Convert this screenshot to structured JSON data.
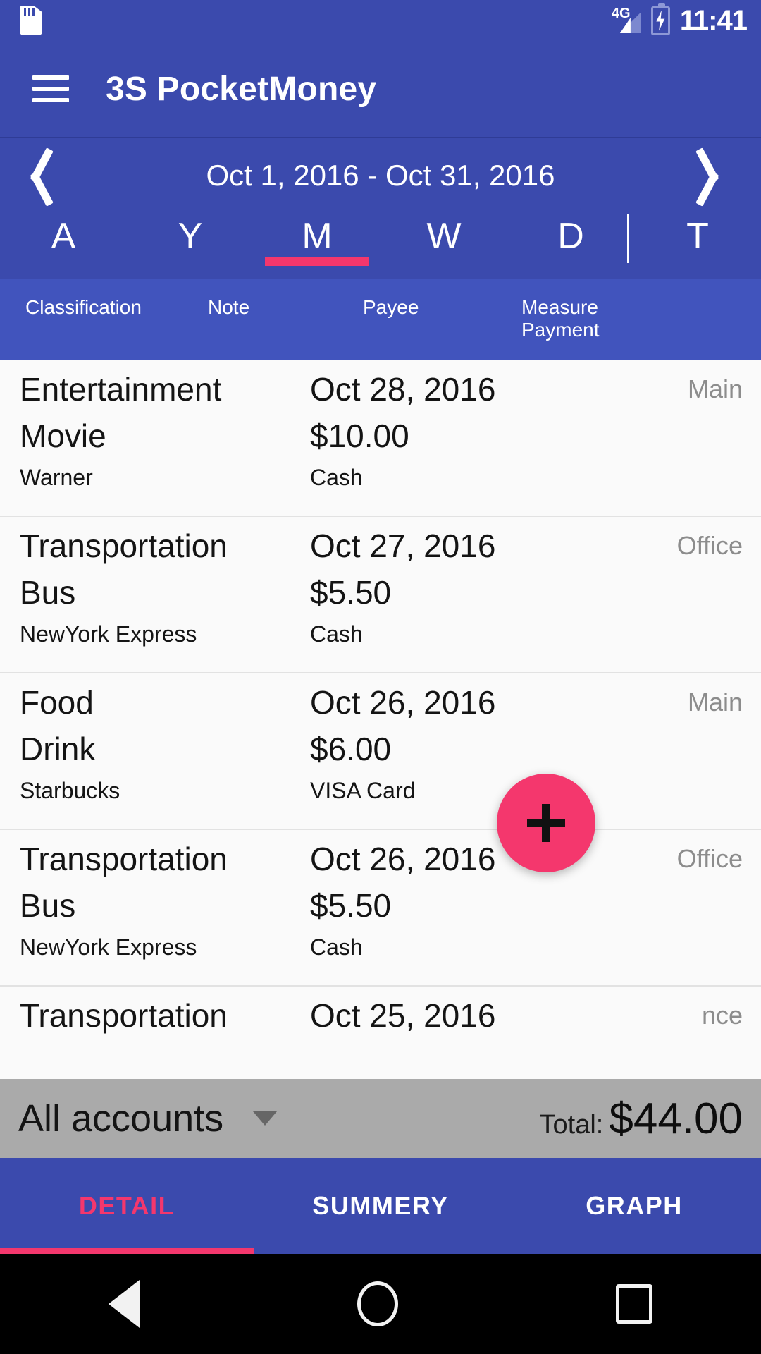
{
  "status_bar": {
    "sd_card_icon": "sd-card-icon",
    "network_label": "4G",
    "signal_icon": "signal-bars-icon",
    "battery_icon": "battery-charging-icon",
    "clock": "11:41"
  },
  "app_bar": {
    "menu_icon": "hamburger-menu-icon",
    "title": "3S PocketMoney"
  },
  "date_nav": {
    "prev_icon": "chevron-left-icon",
    "next_icon": "chevron-right-icon",
    "range": "Oct 1, 2016 - Oct 31, 2016"
  },
  "period_tabs": {
    "items": [
      {
        "label": "A",
        "active": false
      },
      {
        "label": "Y",
        "active": false
      },
      {
        "label": "M",
        "active": true
      },
      {
        "label": "W",
        "active": false
      },
      {
        "label": "D",
        "active": false
      },
      {
        "label": "T",
        "active": false
      }
    ],
    "active_indicator_color": "#f4376d"
  },
  "column_headers": {
    "classification": "Classification",
    "note": "Note",
    "payee": "Payee",
    "measure": "Measure",
    "payment": "Payment"
  },
  "transactions": [
    {
      "classification": "Entertainment",
      "note": "Movie",
      "payee": "Warner",
      "date": "Oct 28, 2016",
      "amount": "$10.00",
      "payment": "Cash",
      "account": "Main"
    },
    {
      "classification": "Transportation",
      "note": "Bus",
      "payee": "NewYork Express",
      "date": "Oct 27, 2016",
      "amount": "$5.50",
      "payment": "Cash",
      "account": "Office"
    },
    {
      "classification": "Food",
      "note": "Drink",
      "payee": "Starbucks",
      "date": "Oct 26, 2016",
      "amount": "$6.00",
      "payment": "VISA Card",
      "account": "Main"
    },
    {
      "classification": "Transportation",
      "note": "Bus",
      "payee": "NewYork Express",
      "date": "Oct 26, 2016",
      "amount": "$5.50",
      "payment": "Cash",
      "account": "Office"
    }
  ],
  "partial_row": {
    "classification": "Transportation",
    "date": "Oct 25, 2016",
    "account": "nce"
  },
  "fab": {
    "icon": "plus-icon",
    "color": "#f4376d"
  },
  "totals_bar": {
    "account_filter": "All accounts",
    "dropdown_icon": "caret-down-icon",
    "total_label": "Total:",
    "total_value": "$44.00"
  },
  "bottom_tabs": {
    "items": [
      {
        "label": "DETAIL",
        "active": true
      },
      {
        "label": "SUMMERY",
        "active": false
      },
      {
        "label": "GRAPH",
        "active": false
      }
    ],
    "active_color": "#f4376d"
  },
  "nav_bar": {
    "back_icon": "back-triangle-icon",
    "home_icon": "home-circle-icon",
    "recents_icon": "recents-square-icon"
  },
  "theme": {
    "primary": "#3b4aad",
    "primary_light": "#4154bd",
    "accent": "#f4376d",
    "total_bar_bg": "#aaaaaa"
  }
}
